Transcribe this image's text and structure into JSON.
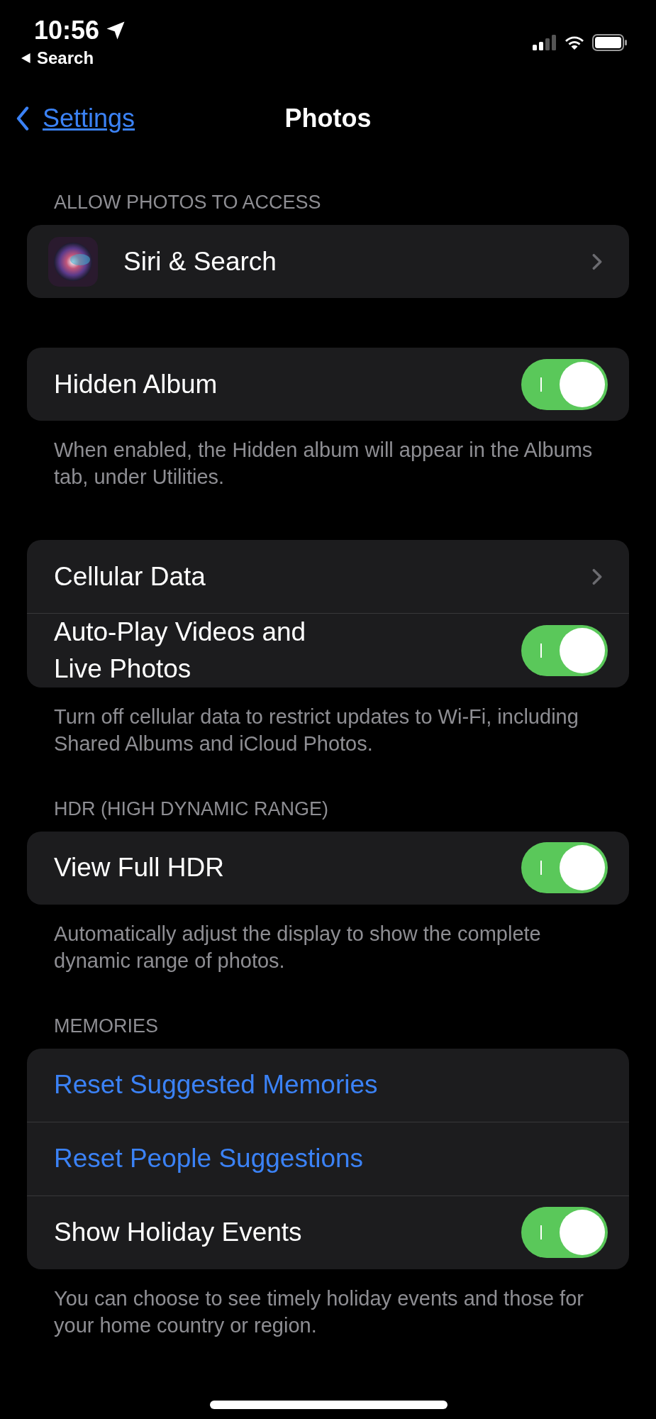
{
  "status_bar": {
    "time": "10:56",
    "back_app": "Search"
  },
  "nav": {
    "back": "Settings",
    "title": "Photos"
  },
  "sections": [
    {
      "header": "ALLOW PHOTOS TO ACCESS",
      "rows": [
        {
          "kind": "app",
          "label": "Siri & Search"
        }
      ]
    },
    {
      "rows": [
        {
          "kind": "toggle",
          "label": "Hidden Album",
          "on": true
        }
      ],
      "footer": "When enabled, the Hidden album will appear in the Albums tab, under Utilities."
    },
    {
      "rows": [
        {
          "kind": "link",
          "label": "Cellular Data"
        },
        {
          "kind": "toggle",
          "label": "Auto-Play Videos and Live Photos",
          "on": true
        }
      ],
      "footer": "Turn off cellular data to restrict updates to Wi-Fi, including Shared Albums and iCloud Photos."
    },
    {
      "header": "HDR (HIGH DYNAMIC RANGE)",
      "rows": [
        {
          "kind": "toggle",
          "label": "View Full HDR",
          "on": true
        }
      ],
      "footer": "Automatically adjust the display to show the complete dynamic range of photos."
    },
    {
      "header": "MEMORIES",
      "rows": [
        {
          "kind": "action",
          "label": "Reset Suggested Memories"
        },
        {
          "kind": "action",
          "label": "Reset People Suggestions"
        },
        {
          "kind": "toggle",
          "label": "Show Holiday Events",
          "on": true
        }
      ],
      "footer": "You can choose to see timely holiday events and those for your home country or region."
    }
  ]
}
